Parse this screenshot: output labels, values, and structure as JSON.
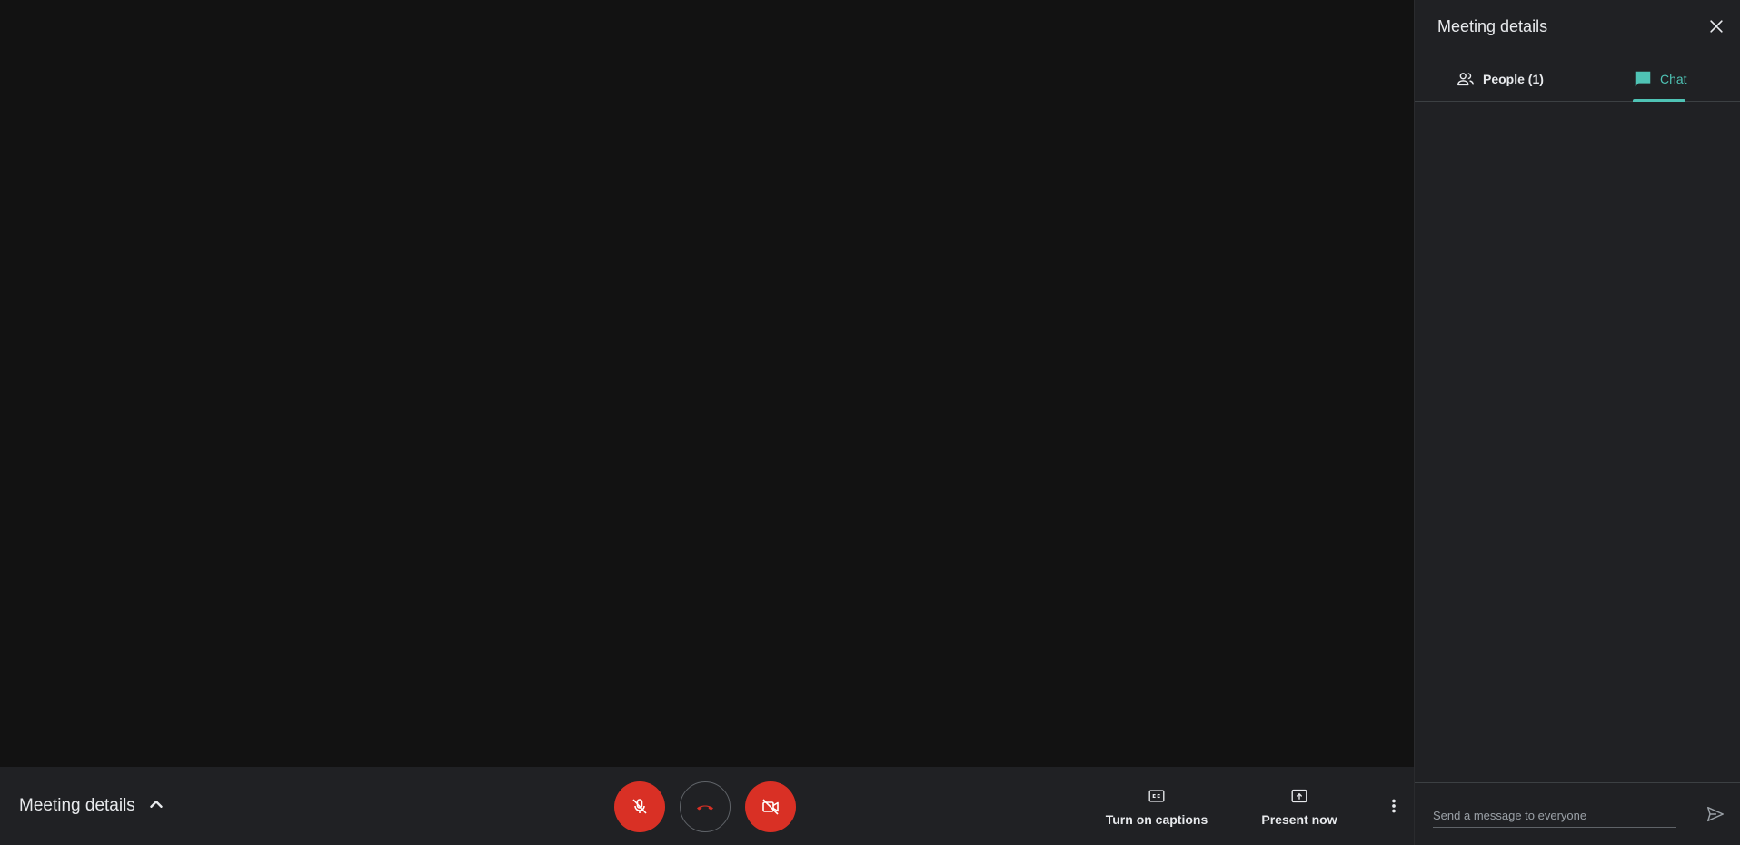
{
  "bottom_bar": {
    "meeting_details_label": "Meeting details",
    "captions_label": "Turn on captions",
    "present_label": "Present now"
  },
  "side_panel": {
    "title": "Meeting details",
    "tabs": [
      {
        "label": "People (1)",
        "icon": "people-icon",
        "active": false
      },
      {
        "label": "Chat",
        "icon": "chat-icon",
        "active": true
      }
    ],
    "message_placeholder": "Send a message to everyone"
  },
  "colors": {
    "stage_bg": "#121212",
    "bar_bg": "#202124",
    "danger": "#d93025",
    "accent": "#4fc3b5",
    "text": "#e8eaed"
  }
}
